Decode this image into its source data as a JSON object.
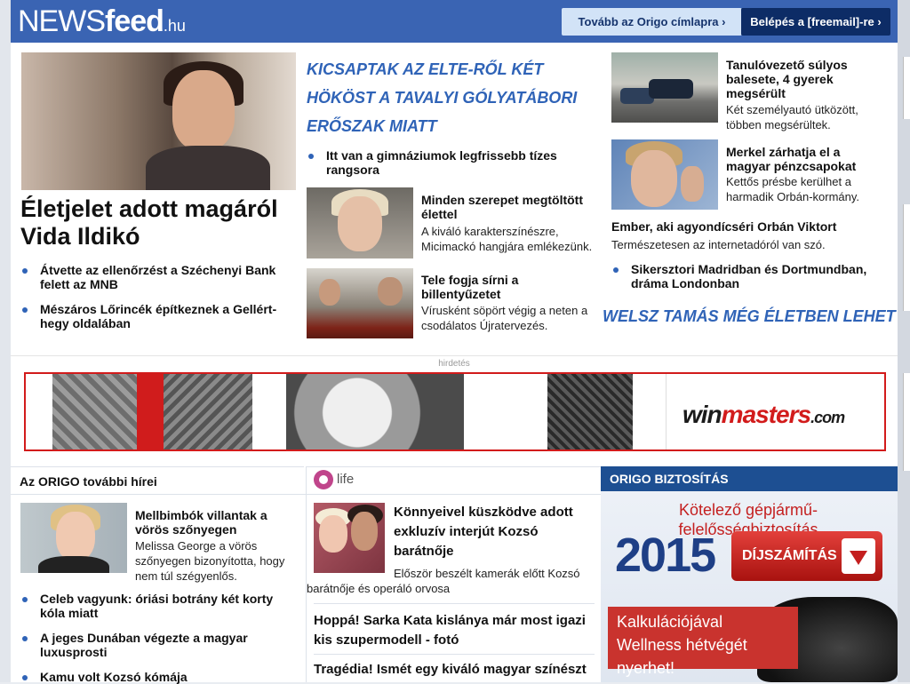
{
  "header": {
    "logo_news": "NEWS",
    "logo_feed": "feed",
    "logo_tld": ".hu",
    "btn_origo": "Tovább az Origo címlapra ›",
    "btn_login": "Belépés a [freemail]-re ›",
    "colors": {
      "bar": "#3a64b3",
      "login_bg": "#0d2c66",
      "origo_bg": "#d2e3f7"
    }
  },
  "lead": {
    "headline": "Életjelet adott magáról Vida Ildikó",
    "bullets": [
      "Átvette az ellenőrzést a Széchenyi Bank felett az MNB",
      "Mészáros Lőrincék építkeznek a Gellért-hegy oldalában"
    ]
  },
  "middle": {
    "headline": "KICSAPTAK AZ ELTE-RŐL KÉT HÖKÖST A TAVALYI GÓLYATÁBORI ERŐSZAK MIATT",
    "bullet": "Itt van a gimnáziumok legfrissebb tízes rangsora",
    "items": [
      {
        "title": "Minden szerepet megtöltött élettel",
        "lead": "A kiváló karakterszínészre, Micimackó hangjára emlékezünk."
      },
      {
        "title": "Tele fogja sírni a billentyűzetet",
        "lead": "Vírusként söpört végig a neten a csodálatos Újratervezés."
      }
    ]
  },
  "right": {
    "items": [
      {
        "title": "Tanulóvezető súlyos balesete, 4 gyerek megsérült",
        "lead": "Két személyautó ütközött, többen megsérültek."
      },
      {
        "title": "Merkel zárhatja el a magyar pénzcsapokat",
        "lead": "Kettős présbe kerülhet a harmadik Orbán-kormány."
      }
    ],
    "ember_title": "Ember, aki agyondícséri Orbán Viktort",
    "ember_lead": "Természetesen az internetadóról van szó.",
    "bullet": "Sikersztori Madridban és Dortmundban, dráma Londonban",
    "welsz": "WELSZ TAMÁS MÉG ÉLETBEN LEHET"
  },
  "ad": {
    "label": "hirdetés",
    "brand_win": "win",
    "brand_masters": "masters",
    "brand_tld": ".com"
  },
  "origo": {
    "heading": "Az ORIGO további hírei",
    "feature_title": "Mellbimbók villantak a vörös szőnyegen",
    "feature_lead": "Melissa George a vörös szőnyegen bizonyította, hogy nem túl szégyenlős.",
    "bullets": [
      "Celeb vagyunk: óriási botrány két korty kóla miatt",
      "A jeges Dunában végezte a magyar luxusprosti",
      "Kamu volt Kozsó kómája"
    ]
  },
  "life": {
    "logo": "life",
    "feature_title": "Könnyeivel küszködve adott exkluzív interjút Kozsó barátnője",
    "feature_lead": "Először beszélt kamerák előtt Kozsó barátnője és operáló orvosa",
    "links": [
      "Hoppá! Sarka Kata kislánya már most igazi kis szupermodell - fotó",
      "Tragédia! Ismét egy kiváló magyar színészt"
    ]
  },
  "insurance": {
    "heading": "ORIGO BIZTOSÍTÁS",
    "red_line": "Kötelező gépjármű-felelősségbiztosítás",
    "year": "2015",
    "button": "DÍJSZÁMÍTÁS",
    "promo": "Kalkulációjával Wellness hétvégét nyerhet!"
  }
}
